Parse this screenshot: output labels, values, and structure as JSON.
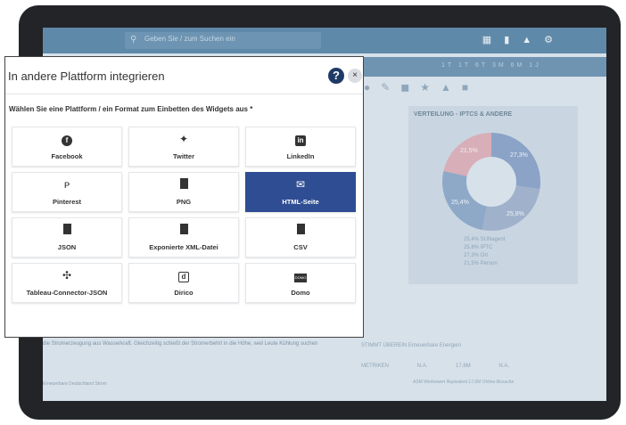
{
  "background": {
    "search_placeholder": "Geben Sie / zum Suchen ein",
    "donut_title": "VERTEILUNG - IPTCS & ANDERE",
    "donut_labels": [
      "21,5%",
      "27,3%",
      "25,4%",
      "25,8%"
    ],
    "legend": [
      "25,4% SUNagent",
      "25,8% IPTC",
      "27,3% Ort",
      "21,5% Person"
    ],
    "bottom_text": "die Stromerzeugung aus Wasserkraft. Gleichzeitig schießt der Stromerbehrt in die Höhe, weil Leute Kühlung suchen",
    "bottom_text2": "Erneuerbare Deutschland Strom",
    "metrics_label": "STIMMT ÜBEREIN   Erneuerbare Energien",
    "metrics": [
      "METRIKEN",
      "N.A.",
      "17,6M",
      "N.A."
    ],
    "metrics_sub": "ASM Werbewert Äquivalent  17,6M Online-Besuche"
  },
  "modal": {
    "title": "In andere Plattform integrieren",
    "help_icon": "?",
    "close_icon": "×",
    "instruction": "Wählen Sie eine Plattform / ein Format zum Einbetten des Widgets aus *",
    "selected": "HTML-Seite",
    "options": [
      {
        "label": "Facebook",
        "icon": "facebook-icon"
      },
      {
        "label": "Twitter",
        "icon": "twitter-icon"
      },
      {
        "label": "LinkedIn",
        "icon": "linkedin-icon"
      },
      {
        "label": "Pinterest",
        "icon": "pinterest-icon"
      },
      {
        "label": "PNG",
        "icon": "image-file-icon"
      },
      {
        "label": "HTML-Seite",
        "icon": "envelope-icon"
      },
      {
        "label": "JSON",
        "icon": "file-icon"
      },
      {
        "label": "Exponierte XML-Datei",
        "icon": "file-icon"
      },
      {
        "label": "CSV",
        "icon": "csv-file-icon"
      },
      {
        "label": "Tableau-Connector-JSON",
        "icon": "tableau-icon"
      },
      {
        "label": "Dirico",
        "icon": "dirico-icon"
      },
      {
        "label": "Domo",
        "icon": "domo-icon"
      }
    ]
  }
}
